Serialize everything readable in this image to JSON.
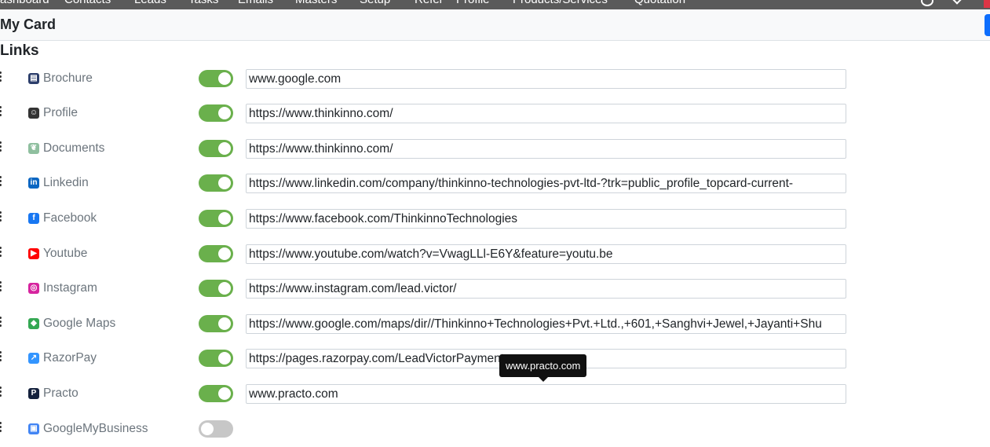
{
  "topnav": {
    "items": [
      "ashboard",
      "Contacts",
      "Leads",
      "Tasks",
      "Emails",
      "Masters",
      "Setup",
      "Refer",
      "Profile",
      "Products/Services",
      "Quotation"
    ]
  },
  "header": {
    "title": "My Card"
  },
  "section": {
    "title": "Links"
  },
  "links": [
    {
      "label": "Brochure",
      "url": "www.google.com",
      "enabled": true,
      "icon": "brochure-icon",
      "color": "#2c3e6b"
    },
    {
      "label": "Profile",
      "url": "https://www.thinkinno.com/",
      "enabled": true,
      "icon": "profile-icon",
      "color": "#333333"
    },
    {
      "label": "Documents",
      "url": "https://www.thinkinno.com/",
      "enabled": true,
      "icon": "documents-icon",
      "color": "#8fbf9f"
    },
    {
      "label": "Linkedin",
      "url": "https://www.linkedin.com/company/thinkinno-technologies-pvt-ltd-?trk=public_profile_topcard-current-",
      "enabled": true,
      "icon": "linkedin-icon",
      "color": "#0a66c2"
    },
    {
      "label": "Facebook",
      "url": "https://www.facebook.com/ThinkinnoTechnologies",
      "enabled": true,
      "icon": "facebook-icon",
      "color": "#1877f2"
    },
    {
      "label": "Youtube",
      "url": "https://www.youtube.com/watch?v=VwagLLl-E6Y&feature=youtu.be",
      "enabled": true,
      "icon": "youtube-icon",
      "color": "#ff0000"
    },
    {
      "label": "Instagram",
      "url": "https://www.instagram.com/lead.victor/",
      "enabled": true,
      "icon": "instagram-icon",
      "color": "#d6249f"
    },
    {
      "label": "Google Maps",
      "url": "https://www.google.com/maps/dir//Thinkinno+Technologies+Pvt.+Ltd.,+601,+Sanghvi+Jewel,+Jayanti+Shu",
      "enabled": true,
      "icon": "google-maps-icon",
      "color": "#34a853"
    },
    {
      "label": "RazorPay",
      "url": "https://pages.razorpay.com/LeadVictorPaymentss",
      "enabled": true,
      "icon": "razorpay-icon",
      "color": "#3395ff"
    },
    {
      "label": "Practo",
      "url": "www.practo.com",
      "enabled": true,
      "icon": "practo-icon",
      "color": "#14213d"
    },
    {
      "label": "GoogleMyBusiness",
      "url": "",
      "enabled": false,
      "icon": "google-my-business-icon",
      "color": "#4285f4"
    }
  ],
  "tooltip": {
    "text": "www.practo.com"
  },
  "colors": {
    "toggle_on": "#6ab04c",
    "toggle_off": "#c7c7c7",
    "label": "#6c757d"
  }
}
